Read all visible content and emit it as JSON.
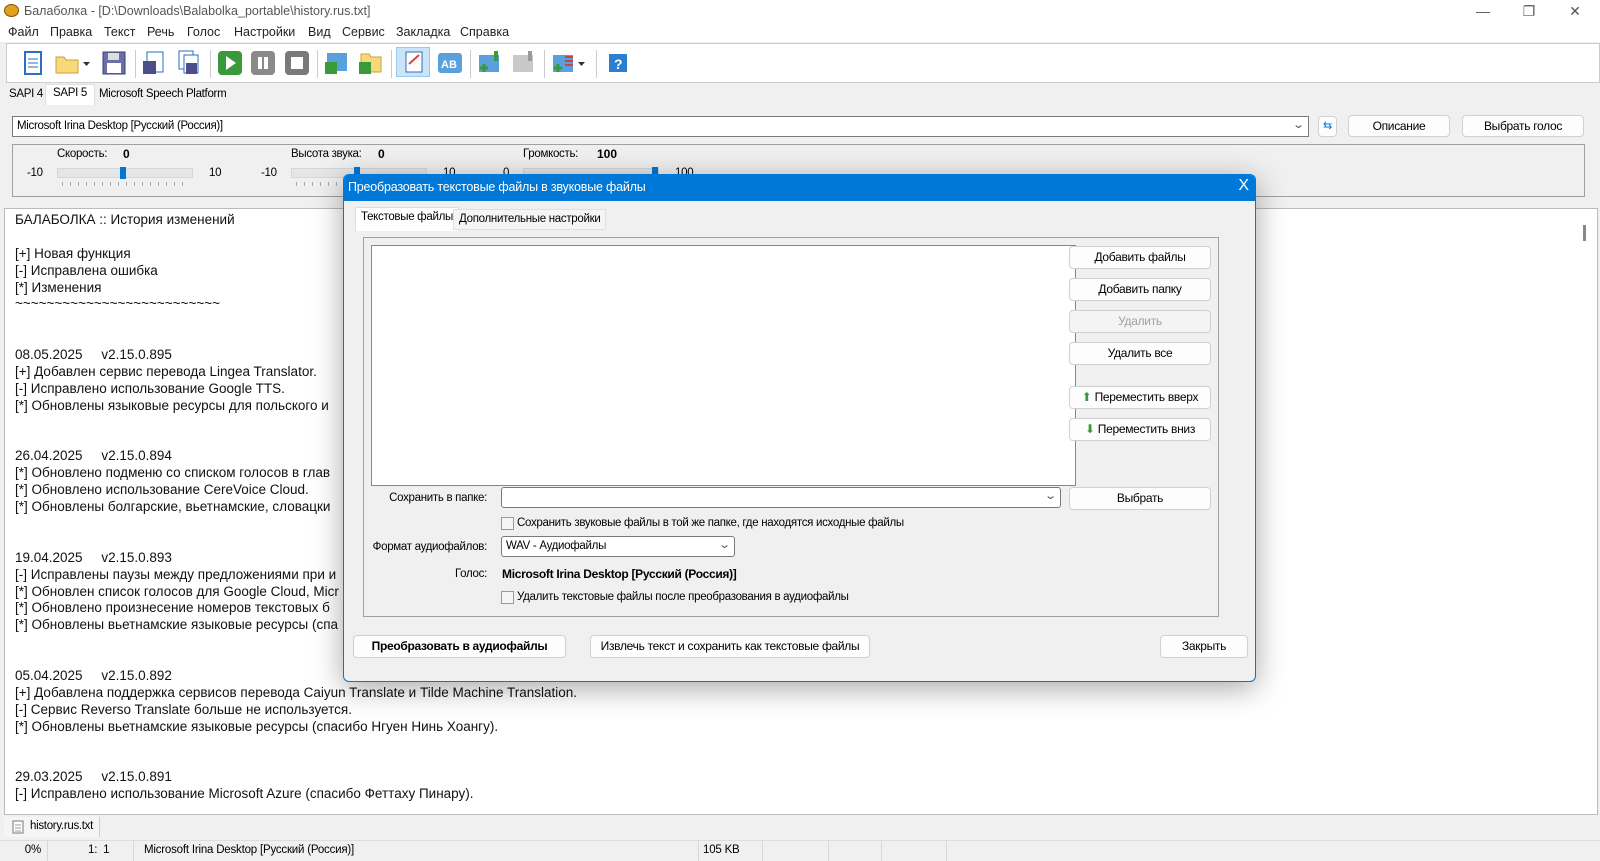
{
  "window": {
    "title": "Балаболка - [D:\\Downloads\\Balabolka_portable\\history.rus.txt]",
    "minimize": "—",
    "maximize": "❐",
    "close": "✕"
  },
  "menu": [
    "Файл",
    "Правка",
    "Текст",
    "Речь",
    "Голос",
    "Настройки",
    "Вид",
    "Сервис",
    "Закладка",
    "Справка"
  ],
  "toolbar": {
    "icons": [
      "new-document-icon",
      "open-folder-icon",
      "open-dropdown-icon",
      "save-icon",
      "save-audio-icon",
      "batch-save-audio-icon",
      "play-icon",
      "pause-icon",
      "stop-icon",
      "read-clipboard-icon",
      "read-folder-icon",
      "spell-check-icon",
      "text-compare-icon",
      "add-bookmark-icon",
      "goto-bookmark-icon",
      "add-list-icon",
      "list-dropdown-icon",
      "help-icon"
    ]
  },
  "engine_tabs": [
    "SAPI 4",
    "SAPI 5",
    "Microsoft Speech Platform"
  ],
  "engine_tab_active": 1,
  "voice": {
    "selected": "Microsoft Irina Desktop [Русский (Россия)]",
    "description_btn": "Описание",
    "choose_voice_btn": "Выбрать голос"
  },
  "sliders": {
    "rate": {
      "label": "Скорость:",
      "value": "0",
      "min": "-10",
      "max": "10"
    },
    "pitch": {
      "label": "Высота звука:",
      "value": "0",
      "min": "-10",
      "max": "10"
    },
    "volume": {
      "label": "Громкость:",
      "value": "100",
      "min": "0",
      "max": "100"
    }
  },
  "editor": {
    "lines": [
      "БАЛАБОЛКА :: История изменений",
      "",
      "[+] Новая функция",
      "[-] Исправлена ошибка",
      "[*] Изменения",
      "~~~~~~~~~~~~~~~~~~~~~~~~~~",
      "",
      "",
      "08.05.2025     v2.15.0.895",
      "[+] Добавлен сервис перевода Lingea Translator.",
      "[-] Исправлено использование Google TTS.",
      "[*] Обновлены языковые ресурсы для польского и",
      "",
      "",
      "26.04.2025     v2.15.0.894",
      "[*] Обновлено подменю со списком голосов в глав",
      "[*] Обновлено использование CereVoice Cloud.",
      "[*] Обновлены болгарские, вьетнамские, словацки",
      "",
      "",
      "19.04.2025     v2.15.0.893",
      "[-] Исправлены паузы между предложениями при и",
      "[*] Обновлен список голосов для Google Cloud, Micr",
      "[*] Обновлено произнесение номеров текстовых б",
      "[*] Обновлены вьетнамские языковые ресурсы (спа",
      "",
      "",
      "05.04.2025     v2.15.0.892",
      "[+] Добавлена поддержка сервисов перевода Caiyun Translate и Tilde Machine Translation.",
      "[-] Сервис Reverso Translate больше не используется.",
      "[*] Обновлены вьетнамские языковые ресурсы (спасибо Нгуен Нинь Хоангу).",
      "",
      "",
      "29.03.2025     v2.15.0.891",
      "[-] Исправлено использование Microsoft Azure (спасибо Феттаху Пинару)."
    ]
  },
  "doc_tab": "history.rus.txt",
  "status": {
    "progress": "0%",
    "position": "1:  1",
    "voice": "Microsoft Irina Desktop [Русский (Россия)]",
    "size": "105 KB"
  },
  "dialog": {
    "title": "Преобразовать текстовые файлы в звуковые файлы",
    "close": "X",
    "tabs": [
      "Текстовые файлы",
      "Дополнительные настройки"
    ],
    "buttons": {
      "add_files": "Добавить файлы",
      "add_folder": "Добавить папку",
      "remove": "Удалить",
      "remove_all": "Удалить все",
      "move_up": "Переместить вверх",
      "move_down": "Переместить вниз",
      "browse": "Выбрать"
    },
    "save_folder_label": "Сохранить в папке:",
    "save_folder_value": "",
    "same_folder_checkbox": "Сохранить звуковые файлы в той же папке, где находятся исходные файлы",
    "format_label": "Формат аудиофайлов:",
    "format_value": "WAV - Аудиофайлы",
    "voice_label": "Голос:",
    "voice_value": "Microsoft Irina Desktop [Русский (Россия)]",
    "delete_checkbox": "Удалить текстовые файлы после преобразования в аудиофайлы",
    "convert_btn": "Преобразовать в аудиофайлы",
    "extract_btn": "Извлечь текст и сохранить как текстовые файлы",
    "close_btn": "Закрыть"
  },
  "colors": {
    "accent": "#0078d7"
  }
}
